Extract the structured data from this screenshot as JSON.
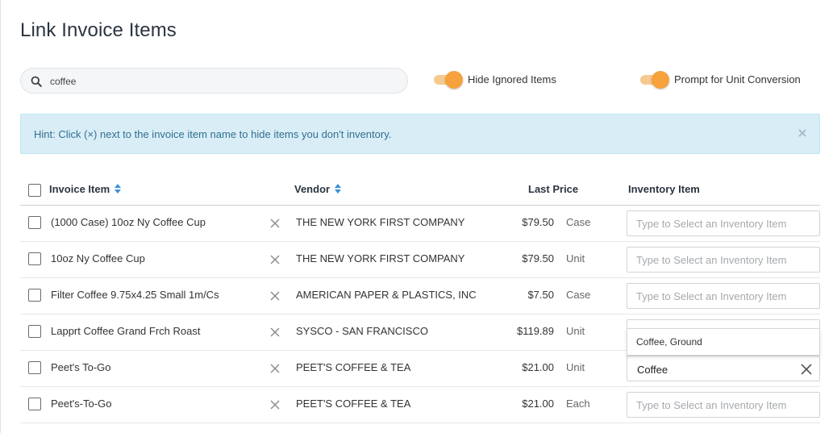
{
  "page": {
    "title": "Link Invoice Items"
  },
  "search": {
    "value": "coffee",
    "icon": "search-icon"
  },
  "toggles": [
    {
      "label": "Hide Ignored Items",
      "on": true
    },
    {
      "label": "Prompt for Unit Conversion",
      "on": true
    }
  ],
  "hint": {
    "text": "Hint: Click (×) next to the invoice item name to hide items you don't inventory.",
    "close_icon": "close-icon"
  },
  "table": {
    "headers": {
      "invoice_item": "Invoice Item",
      "vendor": "Vendor",
      "last_price": "Last Price",
      "inventory_item": "Inventory Item"
    },
    "placeholder": "Type to Select an Inventory Item",
    "rows": [
      {
        "name": "(1000 Case) 10oz Ny Coffee Cup",
        "vendor": "THE NEW YORK FIRST COMPANY",
        "price": "$79.50",
        "unit": "Case",
        "inventory": ""
      },
      {
        "name": "10oz Ny Coffee Cup",
        "vendor": "THE NEW YORK FIRST COMPANY",
        "price": "$79.50",
        "unit": "Unit",
        "inventory": ""
      },
      {
        "name": "Filter Coffee 9.75x4.25 Small 1m/Cs",
        "vendor": "AMERICAN PAPER & PLASTICS, INC",
        "price": "$7.50",
        "unit": "Case",
        "inventory": ""
      },
      {
        "name": "Lapprt Coffee Grand Frch Roast",
        "vendor": "SYSCO - SAN FRANCISCO",
        "price": "$119.89",
        "unit": "Unit",
        "inventory": ""
      },
      {
        "name": "Peet's To-Go",
        "vendor": "PEET'S COFFEE & TEA",
        "price": "$21.00",
        "unit": "Unit",
        "inventory": "Coffee"
      },
      {
        "name": "Peet's-To-Go",
        "vendor": "PEET'S COFFEE & TEA",
        "price": "$21.00",
        "unit": "Each",
        "inventory": ""
      }
    ]
  },
  "dropdown": {
    "options": [
      "Coffee, Ground"
    ]
  },
  "colors": {
    "accent": "#f7a13d",
    "hint_bg": "#d9edf7",
    "hint_text": "#31708f",
    "sort_icon": "#3a8fd9"
  }
}
